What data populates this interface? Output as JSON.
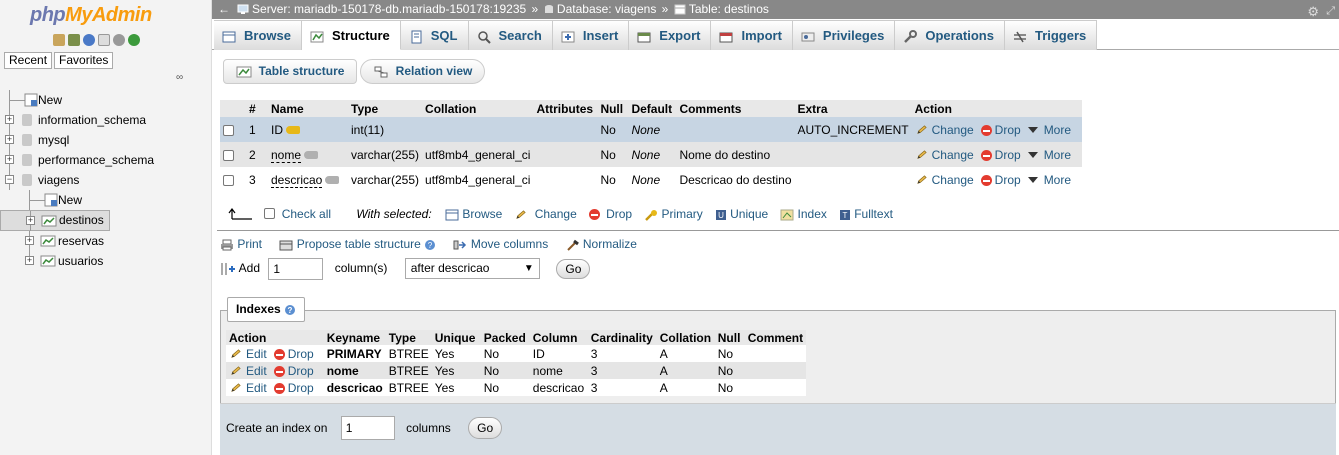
{
  "sidebar": {
    "logo_php": "php",
    "logo_myadmin": "MyAdmin",
    "tabs": [
      "Recent",
      "Favorites"
    ],
    "tree": [
      {
        "label": "New",
        "level": 0,
        "icon": "new-icon"
      },
      {
        "label": "information_schema",
        "level": 0,
        "icon": "database-icon"
      },
      {
        "label": "mysql",
        "level": 0,
        "icon": "database-icon"
      },
      {
        "label": "performance_schema",
        "level": 0,
        "icon": "database-icon"
      },
      {
        "label": "viagens",
        "level": 0,
        "icon": "database-icon"
      },
      {
        "label": "New",
        "level": 1,
        "icon": "new-icon"
      },
      {
        "label": "destinos",
        "level": 1,
        "icon": "table-icon",
        "selected": true
      },
      {
        "label": "reservas",
        "level": 1,
        "icon": "table-icon"
      },
      {
        "label": "usuarios",
        "level": 1,
        "icon": "table-icon"
      }
    ]
  },
  "breadcrumb": {
    "server": "Server: mariadb-150178-db.mariadb-150178:19235",
    "sep": "»",
    "database": "Database: viagens",
    "table": "Table: destinos"
  },
  "tabs": [
    {
      "label": "Browse",
      "icon": "browse-icon"
    },
    {
      "label": "Structure",
      "icon": "structure-icon",
      "active": true
    },
    {
      "label": "SQL",
      "icon": "sql-icon"
    },
    {
      "label": "Search",
      "icon": "search-icon"
    },
    {
      "label": "Insert",
      "icon": "insert-icon"
    },
    {
      "label": "Export",
      "icon": "export-icon"
    },
    {
      "label": "Import",
      "icon": "import-icon"
    },
    {
      "label": "Privileges",
      "icon": "privileges-icon"
    },
    {
      "label": "Operations",
      "icon": "wrench-icon"
    },
    {
      "label": "Triggers",
      "icon": "triggers-icon"
    }
  ],
  "subtabs": {
    "table_structure": "Table structure",
    "relation_view": "Relation view"
  },
  "structure": {
    "headers": [
      "#",
      "Name",
      "Type",
      "Collation",
      "Attributes",
      "Null",
      "Default",
      "Comments",
      "Extra",
      "Action"
    ],
    "rows": [
      {
        "num": "1",
        "name": "ID",
        "type": "int(11)",
        "collation": "",
        "attributes": "",
        "null": "No",
        "default": "None",
        "comments": "",
        "extra": "AUTO_INCREMENT",
        "key": "primary"
      },
      {
        "num": "2",
        "name": "nome",
        "type": "varchar(255)",
        "collation": "utf8mb4_general_ci",
        "attributes": "",
        "null": "No",
        "default": "None",
        "comments": "Nome do destino",
        "extra": "",
        "key": "index"
      },
      {
        "num": "3",
        "name": "descricao",
        "type": "varchar(255)",
        "collation": "utf8mb4_general_ci",
        "attributes": "",
        "null": "No",
        "default": "None",
        "comments": "Descricao do destino",
        "extra": "",
        "key": "index"
      }
    ],
    "actions": {
      "change": "Change",
      "drop": "Drop",
      "more": "More"
    }
  },
  "with_selected": {
    "check_all": "Check all",
    "label": "With selected:",
    "items": [
      "Browse",
      "Change",
      "Drop",
      "Primary",
      "Unique",
      "Index",
      "Fulltext"
    ]
  },
  "tools": {
    "print": "Print",
    "propose": "Propose table structure",
    "move_columns": "Move columns",
    "normalize": "Normalize"
  },
  "add_columns": {
    "label": "Add",
    "value": "1",
    "columns_label": "column(s)",
    "position": "after descricao",
    "go": "Go"
  },
  "indexes": {
    "legend": "Indexes",
    "headers": [
      "Action",
      "Keyname",
      "Type",
      "Unique",
      "Packed",
      "Column",
      "Cardinality",
      "Collation",
      "Null",
      "Comment"
    ],
    "rows": [
      {
        "keyname": "PRIMARY",
        "type": "BTREE",
        "unique": "Yes",
        "packed": "No",
        "column": "ID",
        "cardinality": "3",
        "collation": "A",
        "null": "No",
        "comment": ""
      },
      {
        "keyname": "nome",
        "type": "BTREE",
        "unique": "Yes",
        "packed": "No",
        "column": "nome",
        "cardinality": "3",
        "collation": "A",
        "null": "No",
        "comment": ""
      },
      {
        "keyname": "descricao",
        "type": "BTREE",
        "unique": "Yes",
        "packed": "No",
        "column": "descricao",
        "cardinality": "3",
        "collation": "A",
        "null": "No",
        "comment": ""
      }
    ],
    "edit": "Edit",
    "drop": "Drop",
    "create_label": "Create an index on",
    "create_value": "1",
    "columns_label": "columns",
    "go": "Go"
  },
  "colors": {
    "link": "#235a81",
    "topbar": "#888888",
    "selected_row": "#c7d5e3"
  }
}
